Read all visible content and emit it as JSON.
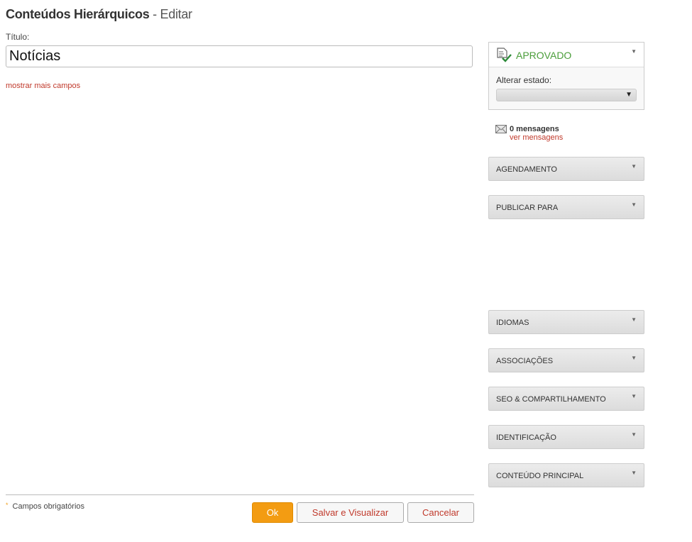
{
  "header": {
    "title_bold": "Conteúdos Hierárquicos",
    "title_rest": " - Editar"
  },
  "form": {
    "title_label": "Título:",
    "title_value": "Notícias",
    "more_fields_link": "mostrar mais campos",
    "required_note": "Campos obrigatórios",
    "required_marker": "*"
  },
  "actions": {
    "ok": "Ok",
    "save_view": "Salvar e Visualizar",
    "cancel": "Cancelar"
  },
  "status": {
    "state": "APROVADO",
    "change_label": "Alterar estado:",
    "selected_option": "",
    "state_color": "#4a9d3a"
  },
  "messages": {
    "count_text": "0 mensagens",
    "link": "ver mensagens"
  },
  "panels": {
    "agendamento": "AGENDAMENTO",
    "publicar_para": "PUBLICAR PARA",
    "idiomas": "IDIOMAS",
    "associacoes": "ASSOCIAÇÕES",
    "seo": "SEO & COMPARTILHAMENTO",
    "identificacao": "IDENTIFICAÇÃO",
    "conteudo_principal": "CONTEÚDO PRINCIPAL"
  },
  "colors": {
    "accent": "#f39c12",
    "link": "#c0392b"
  }
}
